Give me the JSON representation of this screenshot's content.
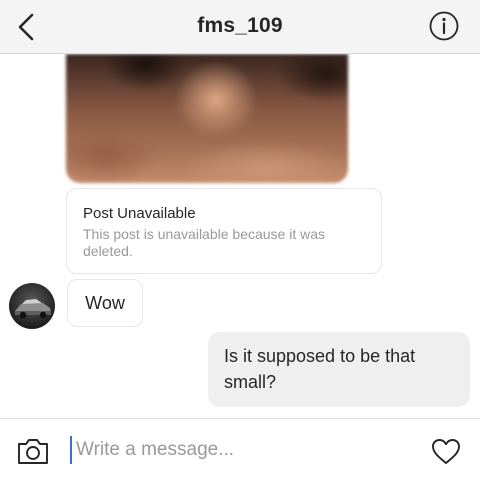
{
  "header": {
    "title": "fms_109",
    "back_icon": "chevron-left-icon",
    "info_icon": "info-circle-icon"
  },
  "messages": {
    "post_unavailable_title": "Post Unavailable",
    "post_unavailable_desc": "This post is unavailable because it was deleted.",
    "received_text": "Wow",
    "sent_text": "Is it supposed to be that small?"
  },
  "composer": {
    "placeholder": "Write a message...",
    "camera_icon": "camera-icon",
    "heart_icon": "heart-icon"
  },
  "colors": {
    "header_bg": "#f4f4f4",
    "sent_bubble_bg": "#efefef",
    "muted_text": "#999999",
    "cursor": "#3b6fd8"
  }
}
